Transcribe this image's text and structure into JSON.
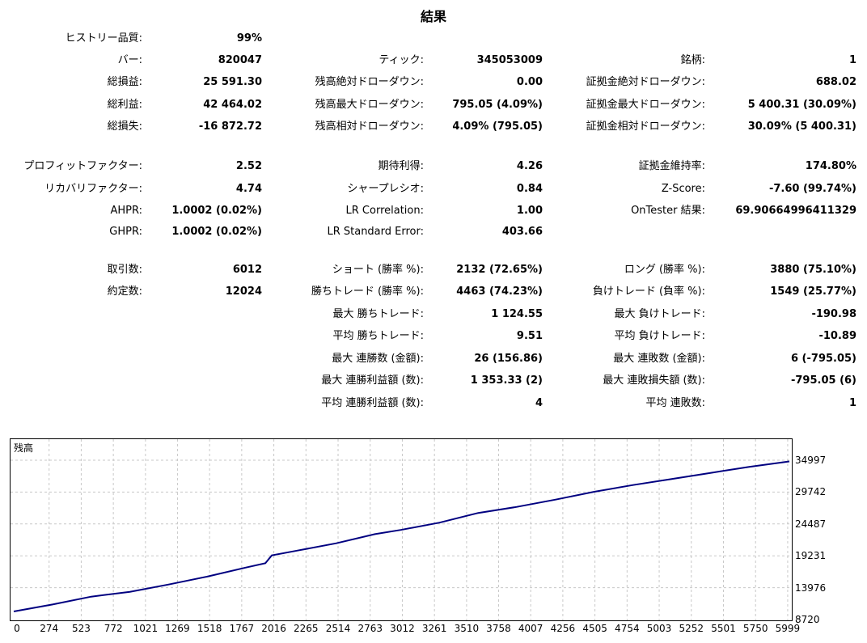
{
  "title": "結果",
  "stats": {
    "history_quality": {
      "label": "ヒストリー品質:",
      "value": "99%"
    },
    "bars": {
      "label": "バー:",
      "value": "820047"
    },
    "ticks": {
      "label": "ティック:",
      "value": "345053009"
    },
    "symbols": {
      "label": "銘柄:",
      "value": "1"
    },
    "net_profit": {
      "label": "総損益:",
      "value": "25 591.30"
    },
    "balance_dd_abs": {
      "label": "残高絶対ドローダウン:",
      "value": "0.00"
    },
    "equity_dd_abs": {
      "label": "証拠金絶対ドローダウン:",
      "value": "688.02"
    },
    "gross_profit": {
      "label": "総利益:",
      "value": "42 464.02"
    },
    "balance_dd_max": {
      "label": "残高最大ドローダウン:",
      "value": "795.05 (4.09%)"
    },
    "equity_dd_max": {
      "label": "証拠金最大ドローダウン:",
      "value": "5 400.31 (30.09%)"
    },
    "gross_loss": {
      "label": "総損失:",
      "value": "-16 872.72"
    },
    "balance_dd_rel": {
      "label": "残高相対ドローダウン:",
      "value": "4.09% (795.05)"
    },
    "equity_dd_rel": {
      "label": "証拠金相対ドローダウン:",
      "value": "30.09% (5 400.31)"
    },
    "profit_factor": {
      "label": "プロフィットファクター:",
      "value": "2.52"
    },
    "expected_payoff": {
      "label": "期待利得:",
      "value": "4.26"
    },
    "margin_level": {
      "label": "証拠金維持率:",
      "value": "174.80%"
    },
    "recovery_factor": {
      "label": "リカバリファクター:",
      "value": "4.74"
    },
    "sharpe_ratio": {
      "label": "シャープレシオ:",
      "value": "0.84"
    },
    "z_score": {
      "label": "Z-Score:",
      "value": "-7.60 (99.74%)"
    },
    "ahpr": {
      "label": "AHPR:",
      "value": "1.0002 (0.02%)"
    },
    "lr_correlation": {
      "label": "LR Correlation:",
      "value": "1.00"
    },
    "ontester": {
      "label": "OnTester 結果:",
      "value": "69.90664996411329"
    },
    "ghpr": {
      "label": "GHPR:",
      "value": "1.0002 (0.02%)"
    },
    "lr_std_error": {
      "label": "LR Standard Error:",
      "value": "403.66"
    },
    "total_trades": {
      "label": "取引数:",
      "value": "6012"
    },
    "short_trades": {
      "label": "ショート (勝率 %):",
      "value": "2132 (72.65%)"
    },
    "long_trades": {
      "label": "ロング (勝率 %):",
      "value": "3880 (75.10%)"
    },
    "total_deals": {
      "label": "約定数:",
      "value": "12024"
    },
    "profit_trades": {
      "label": "勝ちトレード (勝率 %):",
      "value": "4463 (74.23%)"
    },
    "loss_trades": {
      "label": "負けトレード (負率 %):",
      "value": "1549 (25.77%)"
    },
    "largest_profit": {
      "label": "最大 勝ちトレード:",
      "value": "1 124.55"
    },
    "largest_loss": {
      "label": "最大 負けトレード:",
      "value": "-190.98"
    },
    "avg_profit": {
      "label": "平均 勝ちトレード:",
      "value": "9.51"
    },
    "avg_loss": {
      "label": "平均 負けトレード:",
      "value": "-10.89"
    },
    "max_consec_wins": {
      "label": "最大 連勝数 (金額):",
      "value": "26 (156.86)"
    },
    "max_consec_losses": {
      "label": "最大 連敗数 (金額):",
      "value": "6 (-795.05)"
    },
    "max_consec_profit": {
      "label": "最大 連勝利益額 (数):",
      "value": "1 353.33 (2)"
    },
    "max_consec_loss": {
      "label": "最大 連敗損失額 (数):",
      "value": "-795.05 (6)"
    },
    "avg_consec_wins": {
      "label": "平均 連勝利益額 (数):",
      "value": "4"
    },
    "avg_consec_losses": {
      "label": "平均 連敗数:",
      "value": "1"
    }
  },
  "chart_data": {
    "type": "line",
    "title": "残高",
    "x_ticks": [
      "0",
      "274",
      "523",
      "772",
      "1021",
      "1269",
      "1518",
      "1767",
      "2016",
      "2265",
      "2514",
      "2763",
      "3012",
      "3261",
      "3510",
      "3758",
      "4007",
      "4256",
      "4505",
      "4754",
      "5003",
      "5252",
      "5501",
      "5750",
      "5999"
    ],
    "y_ticks": [
      "34997",
      "29742",
      "24487",
      "19231",
      "13976",
      "8720"
    ],
    "ylim": [
      8720,
      34997
    ],
    "xlim": [
      0,
      6012
    ],
    "grid": true,
    "line_color": "#000080",
    "series": [
      {
        "x": [
          0,
          300,
          600,
          900,
          1200,
          1500,
          1800,
          1950,
          2000,
          2200,
          2500,
          2800,
          3000,
          3300,
          3600,
          3900,
          4200,
          4500,
          4800,
          5100,
          5400,
          5700,
          6012
        ],
        "values": [
          10050,
          11200,
          12500,
          13300,
          14500,
          15800,
          17300,
          18000,
          19300,
          20100,
          21300,
          22800,
          23500,
          24700,
          26300,
          27300,
          28500,
          29800,
          30900,
          31900,
          32900,
          33900,
          34800
        ]
      }
    ]
  }
}
